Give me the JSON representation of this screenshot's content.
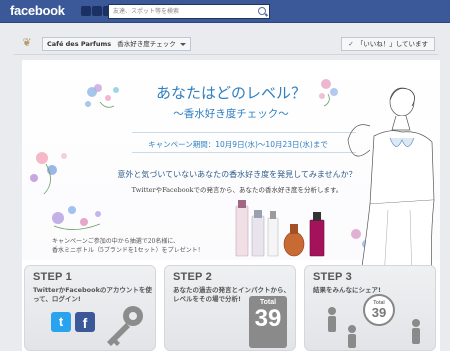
{
  "facebook": {
    "logo": "facebook",
    "search_placeholder": "友達、スポット等を検索"
  },
  "page": {
    "name": "Café des Parfums",
    "app": "香水好き度チェック",
    "like_label": "「いいね！」しています",
    "like_check": "✓"
  },
  "campaign": {
    "headline": "あなたはどのレベル？",
    "subhead": "〜香水好き度チェック〜",
    "period": "キャンペーン期間：10月9日(水)〜10月23日(水)まで",
    "intro_line1": "意外と気づいていないあなたの香水好き度を発見してみませんか？",
    "intro_line2": "TwitterやFacebookでの発言から、あなたの香水好き度を分析します。",
    "gift_line1": "キャンペーンご参加の中から抽選で20名様に、",
    "gift_line2": "香水ミニボトル（5ブランドを1セット）をプレゼント！"
  },
  "steps": [
    {
      "title": "STEP 1",
      "desc": "TwitterかFacebookのアカウントを使って、ログイン!",
      "icon_a": "t",
      "icon_b": "f"
    },
    {
      "title": "STEP 2",
      "desc": "あなたの過去の発言とインパクトから、レベルをその場で分析!",
      "badge_label": "Total",
      "badge_value": "39"
    },
    {
      "title": "STEP 3",
      "desc": "結果をみんなにシェア!",
      "badge_label": "Total",
      "badge_value": "39"
    }
  ],
  "colors": {
    "fb_blue": "#3b5998",
    "accent_blue": "#2f7fc1",
    "twitter": "#2aa3ef"
  }
}
